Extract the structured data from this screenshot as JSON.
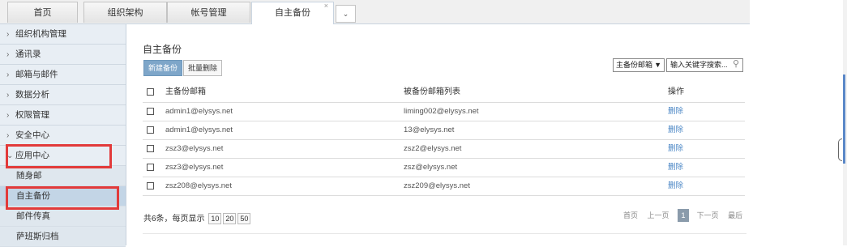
{
  "tabs": [
    {
      "label": "首页"
    },
    {
      "label": "组织架构"
    },
    {
      "label": "帐号管理"
    },
    {
      "label": "自主备份",
      "active": true,
      "close": "×"
    }
  ],
  "tab_more_icon": "chevron-down-icon",
  "sidebar": {
    "items": [
      {
        "label": "组织机构管理",
        "chevron": "›"
      },
      {
        "label": "通讯录",
        "chevron": "›"
      },
      {
        "label": "邮箱与邮件",
        "chevron": "›"
      },
      {
        "label": "数据分析",
        "chevron": "›"
      },
      {
        "label": "权限管理",
        "chevron": "›"
      },
      {
        "label": "安全中心",
        "chevron": "›"
      },
      {
        "label": "应用中心",
        "chevron": "⌄",
        "expanded": true
      }
    ],
    "subitems": [
      {
        "label": "随身邮"
      },
      {
        "label": "自主备份",
        "selected": true
      },
      {
        "label": "邮件传真"
      },
      {
        "label": "萨班斯归档"
      }
    ]
  },
  "main": {
    "title": "自主备份",
    "new_button": "新建备份",
    "batch_delete_button": "批量删除",
    "filter_select": "主备份邮箱",
    "search_placeholder": "输入关键字搜索...",
    "columns": [
      "主备份邮箱",
      "被备份邮箱列表",
      "操作"
    ],
    "rows": [
      {
        "primary": "admin1@elysys.net",
        "backup": "liming002@elysys.net",
        "action": "删除"
      },
      {
        "primary": "admin1@elysys.net",
        "backup": "13@elysys.net",
        "action": "删除"
      },
      {
        "primary": "zsz3@elysys.net",
        "backup": "zsz2@elysys.net",
        "action": "删除"
      },
      {
        "primary": "zsz3@elysys.net",
        "backup": "zsz@elysys.net",
        "action": "删除"
      },
      {
        "primary": "zsz208@elysys.net",
        "backup": "zsz209@elysys.net",
        "action": "删除"
      }
    ],
    "footer": {
      "summary": "共6条，每页显示",
      "page_sizes": [
        "10",
        "20",
        "50"
      ]
    },
    "pager": {
      "first": "首页",
      "prev": "上一页",
      "current": "1",
      "next": "下一页",
      "last": "最后"
    }
  },
  "colors": {
    "highlight": "#e23a3a",
    "primary_button": "#7ea6c9",
    "link": "#4a86c5",
    "sidebar_bg": "#e8eef4"
  }
}
